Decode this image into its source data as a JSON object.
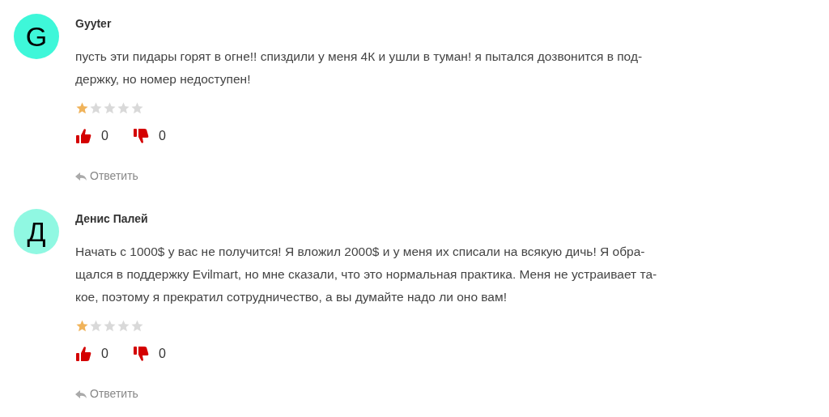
{
  "reviews": [
    {
      "avatar": {
        "letter": "G",
        "color": "#3ef7d9"
      },
      "author": "Gyyter",
      "lines": [
        "пусть эти пидары горят в огне!! спиздили у меня 4К и ушли в туман! я пытался дозвонится в под-",
        "держку, но номер недоступен!"
      ],
      "stars": 1,
      "likes": "0",
      "dislikes": "0",
      "reply": "Ответить"
    },
    {
      "avatar": {
        "letter": "Д",
        "color": "#90f8e2"
      },
      "author": "Денис Палей",
      "lines": [
        "Начать с 1000$ у вас не получится! Я вложил 2000$ и у меня их списали на всякую дичь! Я обра-",
        "щался в поддержку Evilmart, но мне сказали, что это нормальная практика. Меня не устраивает та-",
        "кое, поэтому я прекратил сотрудничество, а вы думайте надо ли оно вам!"
      ],
      "stars": 1,
      "likes": "0",
      "dislikes": "0",
      "reply": "Ответить"
    }
  ]
}
